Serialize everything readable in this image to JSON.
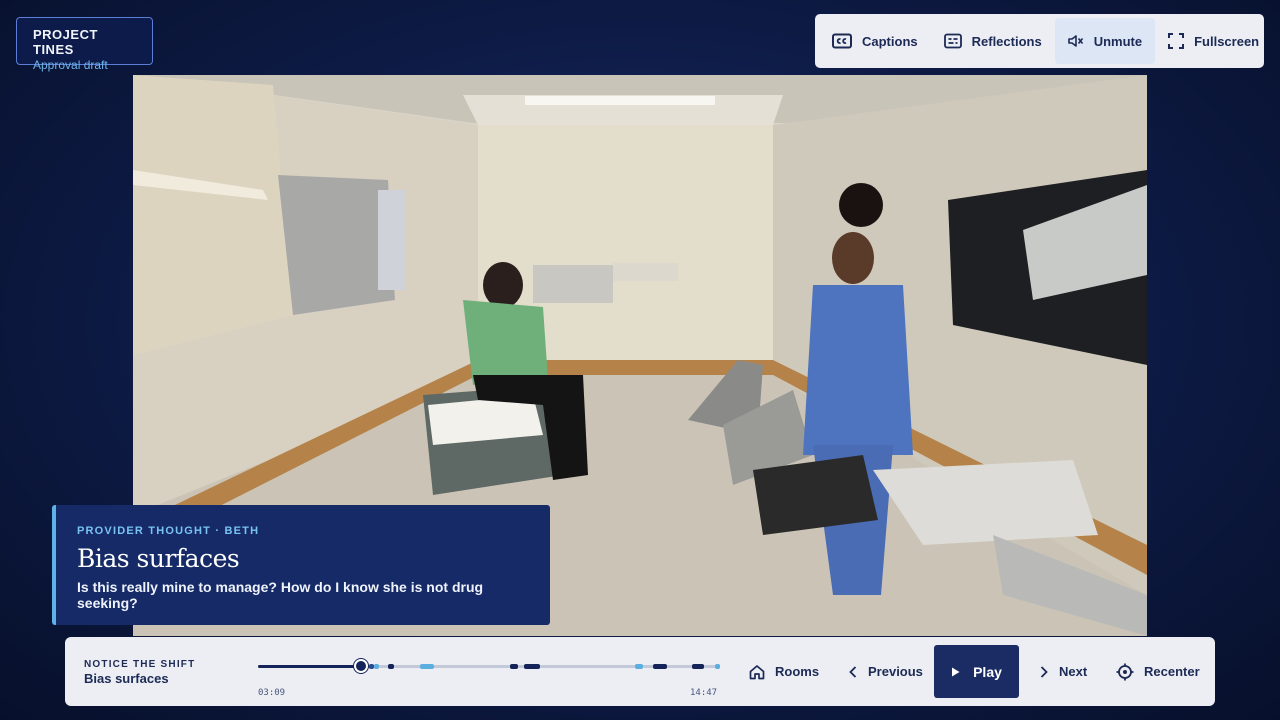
{
  "project": {
    "title": "PROJECT TINES",
    "subtitle": "Approval draft"
  },
  "toolbar": {
    "captions": "Captions",
    "reflections": "Reflections",
    "unmute": "Unmute",
    "fullscreen": "Fullscreen"
  },
  "thought": {
    "kicker": "PROVIDER THOUGHT · BETH",
    "title": "Bias surfaces",
    "body": "Is this really mine to manage? How do I know she is not drug seeking?"
  },
  "chapter": {
    "kicker": "NOTICE THE SHIFT",
    "title": "Bias surfaces"
  },
  "timeline": {
    "current": "03:09",
    "total": "14:47",
    "progress": 0.222,
    "markers": [
      {
        "pos": 0.24,
        "width": 0.012,
        "color": "#2b4a8a"
      },
      {
        "pos": 0.25,
        "width": 0.012,
        "color": "#5aaee0"
      },
      {
        "pos": 0.282,
        "width": 0.012,
        "color": "#142458"
      },
      {
        "pos": 0.35,
        "width": 0.03,
        "color": "#5aaee0"
      },
      {
        "pos": 0.545,
        "width": 0.018,
        "color": "#142458"
      },
      {
        "pos": 0.575,
        "width": 0.035,
        "color": "#142458"
      },
      {
        "pos": 0.815,
        "width": 0.018,
        "color": "#5aaee0"
      },
      {
        "pos": 0.855,
        "width": 0.03,
        "color": "#142458"
      },
      {
        "pos": 0.94,
        "width": 0.025,
        "color": "#142458"
      },
      {
        "pos": 0.99,
        "width": 0.01,
        "color": "#5aaee0"
      }
    ]
  },
  "controls": {
    "rooms": "Rooms",
    "previous": "Previous",
    "play": "Play",
    "next": "Next",
    "recenter": "Recenter"
  },
  "colors": {
    "accent": "#5db3e8",
    "navy": "#1b2c64",
    "panel": "#eceef4"
  }
}
